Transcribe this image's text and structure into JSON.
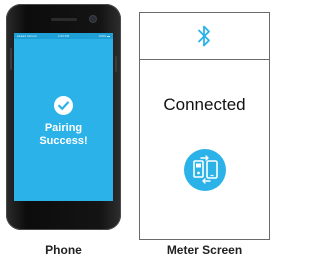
{
  "phone": {
    "status_bar": {
      "carrier": "●●●●● Verizon ",
      "time": "4:20 PM",
      "battery": "100% ▬"
    },
    "message_line1": "Pairing",
    "message_line2": "Success!",
    "label": "Phone",
    "screen_color": "#2ab2e9",
    "icon": "checkmark-circle-icon"
  },
  "meter": {
    "status": "Connected",
    "label": "Meter Screen",
    "icons": [
      "bluetooth-icon",
      "device-sync-icon"
    ],
    "accent_color": "#2ab2e9"
  }
}
